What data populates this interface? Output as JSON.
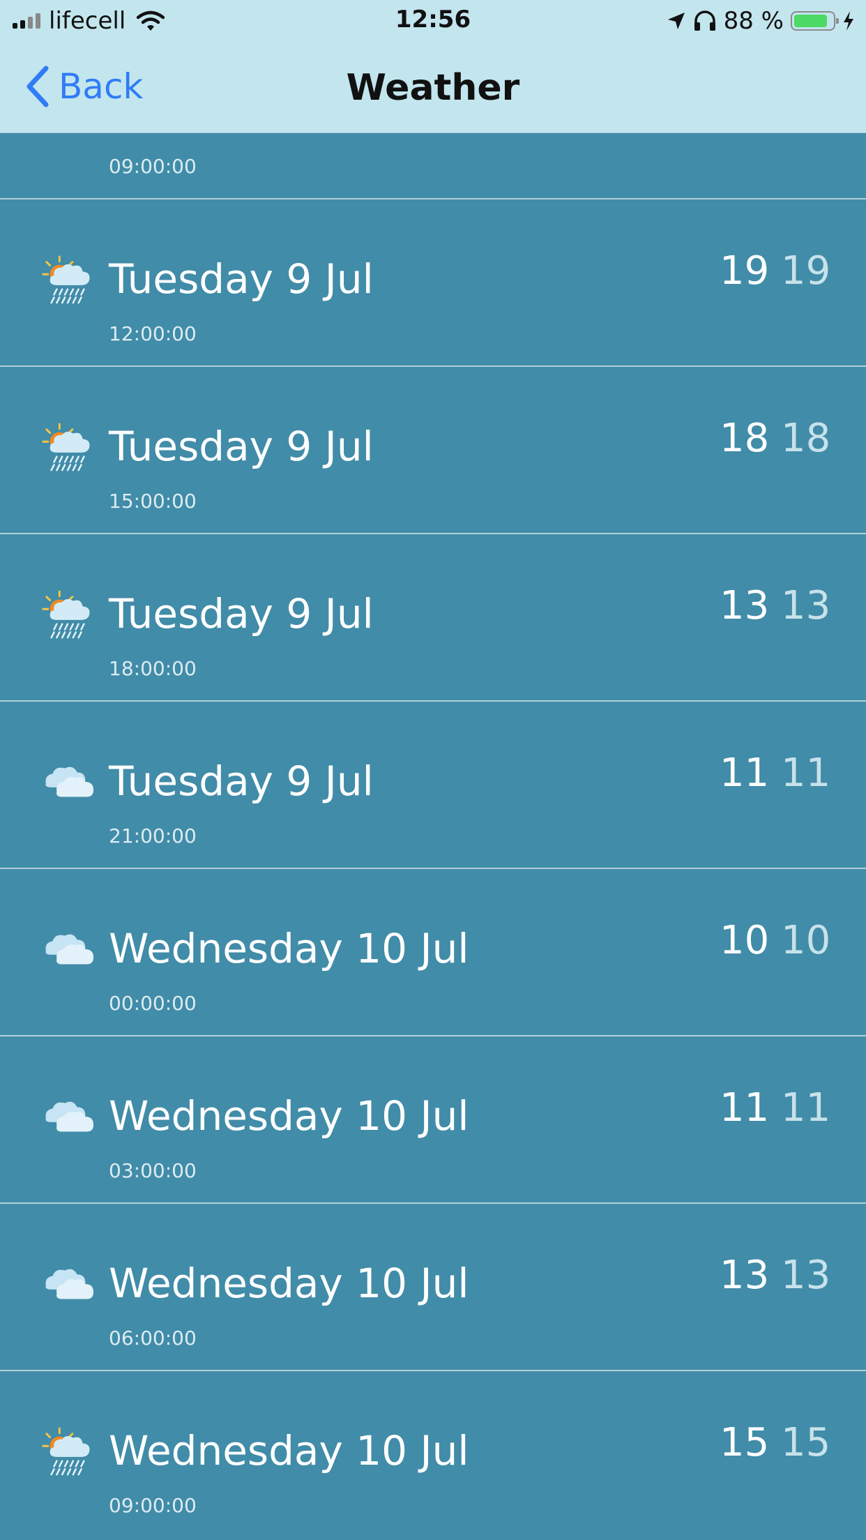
{
  "status_bar": {
    "carrier": "lifecell",
    "time": "12:56",
    "battery_percent": "88 %",
    "battery_level": 0.88
  },
  "nav": {
    "back_label": "Back",
    "title": "Weather"
  },
  "rows": [
    {
      "day": "",
      "time": "09:00:00",
      "temp_a": "",
      "temp_b": "",
      "icon": "sun-cloud-rain-icon"
    },
    {
      "day": "Tuesday 9 Jul",
      "time": "12:00:00",
      "temp_a": "19",
      "temp_b": "19",
      "icon": "sun-cloud-rain-icon"
    },
    {
      "day": "Tuesday 9 Jul",
      "time": "15:00:00",
      "temp_a": "18",
      "temp_b": "18",
      "icon": "sun-cloud-rain-icon"
    },
    {
      "day": "Tuesday 9 Jul",
      "time": "18:00:00",
      "temp_a": "13",
      "temp_b": "13",
      "icon": "sun-cloud-rain-icon"
    },
    {
      "day": "Tuesday 9 Jul",
      "time": "21:00:00",
      "temp_a": "11",
      "temp_b": "11",
      "icon": "clouds-icon"
    },
    {
      "day": "Wednesday 10 Jul",
      "time": "00:00:00",
      "temp_a": "10",
      "temp_b": "10",
      "icon": "clouds-icon"
    },
    {
      "day": "Wednesday 10 Jul",
      "time": "03:00:00",
      "temp_a": "11",
      "temp_b": "11",
      "icon": "clouds-icon"
    },
    {
      "day": "Wednesday 10 Jul",
      "time": "06:00:00",
      "temp_a": "13",
      "temp_b": "13",
      "icon": "clouds-icon"
    },
    {
      "day": "Wednesday 10 Jul",
      "time": "09:00:00",
      "temp_a": "15",
      "temp_b": "15",
      "icon": "sun-cloud-rain-icon"
    }
  ],
  "colors": {
    "list_background": "#418ca8",
    "header_background": "#c3e5ee",
    "accent": "#2f7cf6"
  }
}
